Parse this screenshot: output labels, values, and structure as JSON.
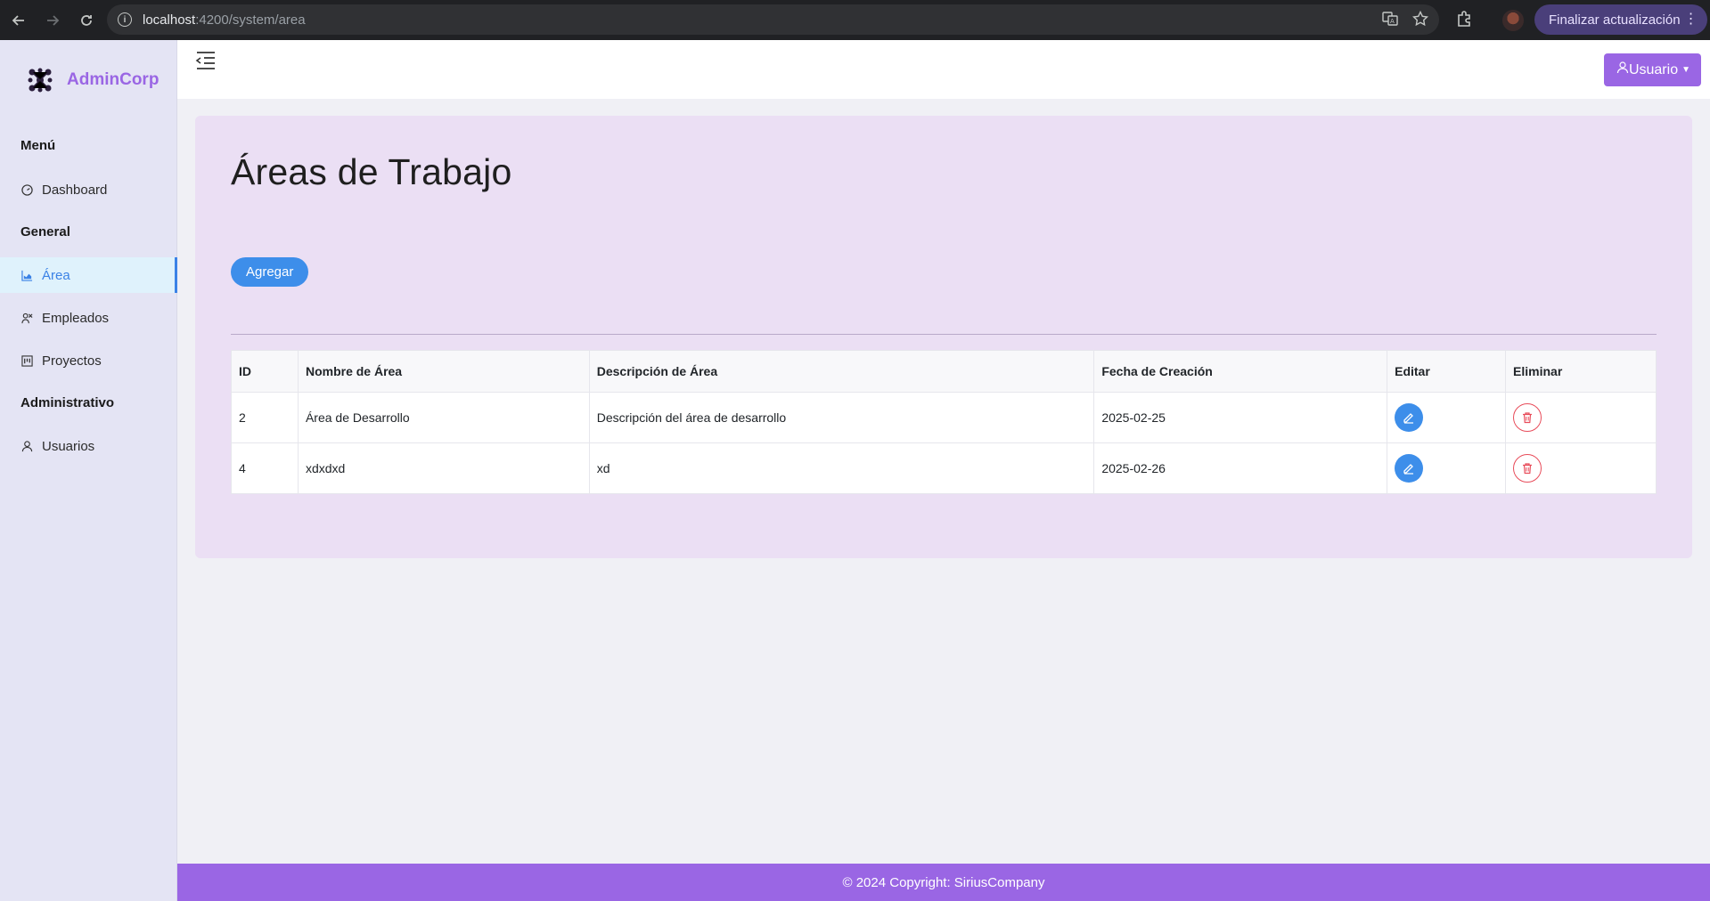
{
  "browser": {
    "url_host": "localhost",
    "url_path": ":4200/system/area",
    "update_label": "Finalizar actualización"
  },
  "brand": {
    "name": "AdminCorp"
  },
  "sidebar": {
    "sections": [
      {
        "title": "Menú"
      },
      {
        "title": "General"
      },
      {
        "title": "Administrativo"
      }
    ],
    "items": [
      {
        "label": "Dashboard",
        "icon": "gauge-icon"
      },
      {
        "label": "Área",
        "icon": "area-chart-icon",
        "active": true
      },
      {
        "label": "Empleados",
        "icon": "users-icon"
      },
      {
        "label": "Proyectos",
        "icon": "kanban-icon"
      },
      {
        "label": "Usuarios",
        "icon": "user-icon"
      }
    ]
  },
  "header": {
    "user_label": "Usuario"
  },
  "main": {
    "title": "Áreas de Trabajo",
    "add_label": "Agregar",
    "table": {
      "headers": [
        "ID",
        "Nombre de Área",
        "Descripción de Área",
        "Fecha de Creación",
        "Editar",
        "Eliminar"
      ],
      "rows": [
        {
          "id": "2",
          "name": "Área de Desarrollo",
          "description": "Descripción del área de desarrollo",
          "date": "2025-02-25"
        },
        {
          "id": "4",
          "name": "xdxdxd",
          "description": "xd",
          "date": "2025-02-26"
        }
      ]
    }
  },
  "footer": {
    "text": "© 2024 Copyright: SiriusCompany"
  },
  "colors": {
    "accent": "#9a66e4",
    "primary": "#3d8eea",
    "danger": "#e84c5a",
    "card_bg": "#ebdff4"
  }
}
